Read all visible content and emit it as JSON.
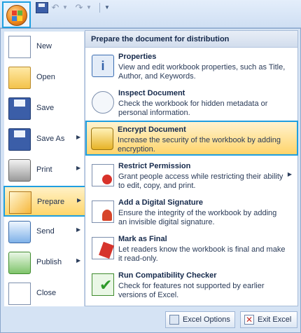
{
  "menu": {
    "left_items": [
      {
        "label": "New",
        "icon": "new-document-icon"
      },
      {
        "label": "Open",
        "icon": "open-folder-icon"
      },
      {
        "label": "Save",
        "icon": "save-disk-icon"
      },
      {
        "label": "Save As",
        "icon": "save-as-icon",
        "submenu": true
      },
      {
        "label": "Print",
        "icon": "printer-icon",
        "submenu": true
      },
      {
        "label": "Prepare",
        "icon": "prepare-icon",
        "submenu": true,
        "active": true
      },
      {
        "label": "Send",
        "icon": "send-icon",
        "submenu": true
      },
      {
        "label": "Publish",
        "icon": "publish-icon",
        "submenu": true
      },
      {
        "label": "Close",
        "icon": "close-document-icon"
      }
    ]
  },
  "prepare": {
    "header": "Prepare the document for distribution",
    "items": [
      {
        "title": "Properties",
        "desc": "View and edit workbook properties, such as Title, Author, and Keywords.",
        "icon": "properties-icon"
      },
      {
        "title": "Inspect Document",
        "desc": "Check the workbook for hidden metadata or personal information.",
        "icon": "inspect-document-icon"
      },
      {
        "title": "Encrypt Document",
        "desc": "Increase the security of the workbook by adding encryption.",
        "icon": "encrypt-key-icon",
        "highlighted": true
      },
      {
        "title": "Restrict Permission",
        "desc": "Grant people access while restricting their ability to edit, copy, and print.",
        "icon": "restrict-permission-icon",
        "submenu": true
      },
      {
        "title": "Add a Digital Signature",
        "desc": "Ensure the integrity of the workbook by adding an invisible digital signature.",
        "icon": "digital-signature-icon"
      },
      {
        "title": "Mark as Final",
        "desc": "Let readers know the workbook is final and make it read-only.",
        "icon": "mark-final-icon"
      },
      {
        "title": "Run Compatibility Checker",
        "desc": "Check for features not supported by earlier versions of Excel.",
        "icon": "compatibility-check-icon"
      }
    ]
  },
  "buttons": {
    "options_label": "Excel Options",
    "exit_label": "Exit Excel"
  },
  "colors": {
    "highlight_border": "#1f9fe0",
    "highlight_fill": "#ffd46a"
  }
}
